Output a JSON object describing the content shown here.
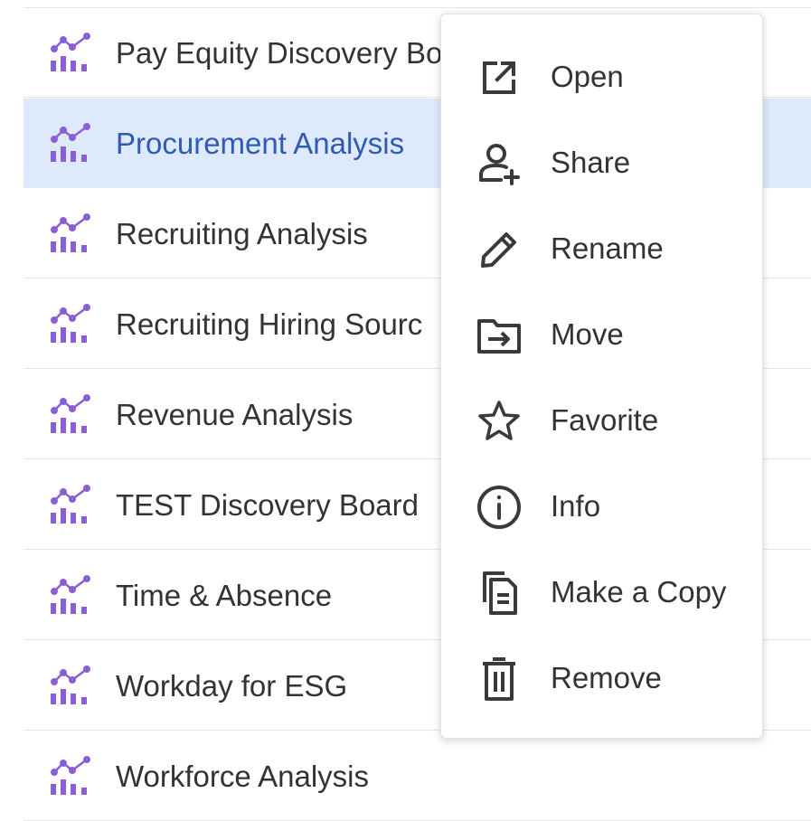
{
  "list": {
    "items": [
      {
        "label": "Pay Equity Discovery Bo",
        "icon": "discovery-board-icon"
      },
      {
        "label": "Procurement Analysis",
        "icon": "discovery-board-icon",
        "selected": true
      },
      {
        "label": "Recruiting Analysis",
        "icon": "discovery-board-icon"
      },
      {
        "label": "Recruiting Hiring Sourc",
        "icon": "discovery-board-icon"
      },
      {
        "label": "Revenue Analysis",
        "icon": "discovery-board-icon"
      },
      {
        "label": "TEST Discovery Board",
        "icon": "discovery-board-icon"
      },
      {
        "label": "Time & Absence",
        "icon": "discovery-board-icon"
      },
      {
        "label": "Workday for ESG",
        "icon": "discovery-board-icon"
      },
      {
        "label": "Workforce Analysis",
        "icon": "discovery-board-icon"
      }
    ]
  },
  "context_menu": {
    "items": [
      {
        "label": "Open",
        "icon": "open-external-icon"
      },
      {
        "label": "Share",
        "icon": "add-person-icon"
      },
      {
        "label": "Rename",
        "icon": "pencil-icon"
      },
      {
        "label": "Move",
        "icon": "move-to-folder-icon"
      },
      {
        "label": "Favorite",
        "icon": "star-icon"
      },
      {
        "label": "Info",
        "icon": "info-icon"
      },
      {
        "label": "Make a Copy",
        "icon": "copy-icon"
      },
      {
        "label": "Remove",
        "icon": "trash-icon"
      }
    ]
  },
  "colors": {
    "icon_purple": "#8a5fd6",
    "selected_bg": "#deeafc",
    "selected_text": "#2e5bb5",
    "text": "#333333",
    "menu_icon": "#3a3a3a"
  }
}
